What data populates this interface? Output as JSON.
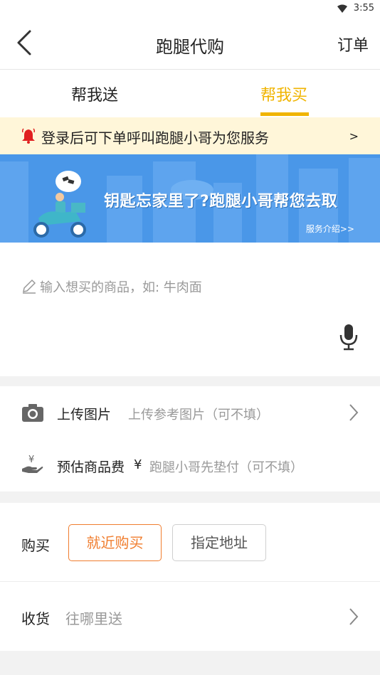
{
  "status_bar": {
    "time": "3:55",
    "wifi_icon": "wifi-icon"
  },
  "app_bar": {
    "title": "跑腿代购",
    "orders_label": "订单",
    "back_icon": "back-arrow-icon"
  },
  "tabs": [
    {
      "label": "帮我送",
      "active": false
    },
    {
      "label": "帮我买",
      "active": true
    }
  ],
  "notice": {
    "text": "登录后可下单呼叫跑腿小哥为您服务",
    "arrow": ">",
    "icon": "bell-icon"
  },
  "banner": {
    "headline": "钥匙忘家里了?跑腿小哥帮您去取",
    "link": "服务介绍>>"
  },
  "goods_input": {
    "placeholder": "输入想买的商品，如: 牛肉面",
    "mic_icon": "microphone-icon"
  },
  "upload_row": {
    "label": "上传图片",
    "hint": "上传参考图片（可不填）",
    "icon": "camera-icon"
  },
  "fee_row": {
    "label": "预估商品费",
    "currency": "¥",
    "hint": "跑腿小哥先垫付（可不填）",
    "icon": "money-hand-icon"
  },
  "buy_row": {
    "label": "购买",
    "options": [
      "就近购买",
      "指定地址"
    ],
    "selected": "就近购买"
  },
  "receive_row": {
    "label": "收货",
    "hint": "往哪里送"
  },
  "colors": {
    "accent": "#f0b400",
    "orange": "#f07d2e",
    "banner_blue": "#4a97e8",
    "notice_bg": "#fff6d9"
  }
}
